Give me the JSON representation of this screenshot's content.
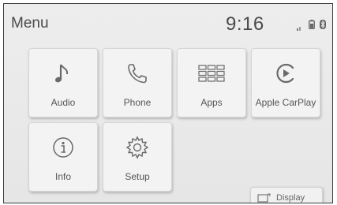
{
  "header": {
    "title": "Menu",
    "clock": "9:16",
    "status_icons": [
      "signal-icon",
      "battery-icon",
      "bluetooth-icon"
    ]
  },
  "tiles": [
    {
      "label": "Audio",
      "icon": "music-note-icon"
    },
    {
      "label": "Phone",
      "icon": "phone-handset-icon"
    },
    {
      "label": "Apps",
      "icon": "apps-grid-icon"
    },
    {
      "label": "Apple CarPlay",
      "icon": "carplay-icon"
    },
    {
      "label": "Info",
      "icon": "info-icon"
    },
    {
      "label": "Setup",
      "icon": "gear-icon"
    }
  ],
  "footer": {
    "display_label": "Display",
    "display_icon": "display-icon"
  },
  "colors": {
    "background": "#e9e9e9",
    "tile": "#f3f3f3",
    "text": "#555555",
    "icon": "#6a6a6a"
  }
}
